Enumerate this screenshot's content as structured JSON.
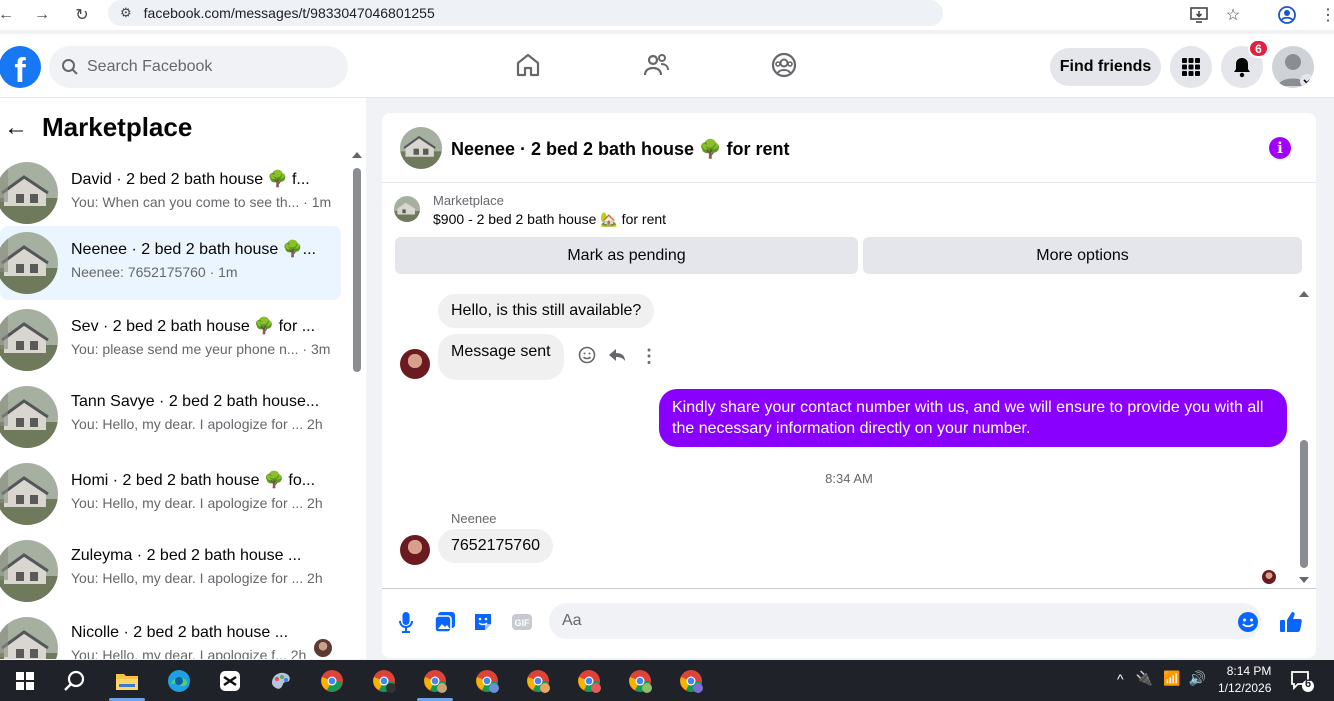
{
  "browser": {
    "url": "facebook.com/messages/t/9833047046801255"
  },
  "header": {
    "logo": "f",
    "search_placeholder": "Search Facebook",
    "find_friends": "Find friends",
    "notif_count": "6"
  },
  "sidebar": {
    "title": "Marketplace",
    "conversations": [
      {
        "title": "David · 2 bed 2 bath house 🌳 f...",
        "subtitle": "You: When can you come to see th... · 1m"
      },
      {
        "title": "Neenee · 2 bed 2 bath house 🌳...",
        "subtitle": "Neenee: 7652175760 · 1m"
      },
      {
        "title": "Sev · 2 bed 2 bath house 🌳 for ...",
        "subtitle": "You: please send me yeur phone n... · 3m"
      },
      {
        "title": "Tann Savye · 2 bed 2 bath house...",
        "subtitle": "You: Hello, my dear. I apologize for ...  2h"
      },
      {
        "title": "Homi · 2 bed 2 bath house 🌳 fo...",
        "subtitle": "You: Hello, my dear. I apologize for ...  2h"
      },
      {
        "title": "Zuleyma · 2 bed 2 bath house ...",
        "subtitle": "You: Hello, my dear. I apologize for ...  2h"
      },
      {
        "title": "Nicolle · 2 bed 2 bath house ...",
        "subtitle": "You: Hello, my dear. I apologize f... 2h"
      }
    ]
  },
  "chat": {
    "title": "Neenee · 2 bed 2 bath house 🌳 for rent",
    "marketplace_label": "Marketplace",
    "listing": "$900 - 2 bed 2 bath house 🏡 for rent",
    "mark_pending": "Mark as pending",
    "more_options": "More options",
    "messages": {
      "in1": "Hello, is this still available?",
      "in2": "Message sent",
      "out1": "Kindly share your contact number with us, and we will ensure to provide you with all the necessary information directly on your number.",
      "timestamp": "8:34 AM",
      "sender": "Neenee",
      "in3": "7652175760"
    },
    "composer_placeholder": "Aa"
  },
  "taskbar": {
    "time": "8:14 PM",
    "date": "1/12/2026",
    "notif_count": "6"
  },
  "colors": {
    "fb_blue": "#1877f2",
    "messenger_purple": "#8a00ff",
    "active_convo": "#ebf5ff",
    "badge_red": "#e41e3f"
  }
}
